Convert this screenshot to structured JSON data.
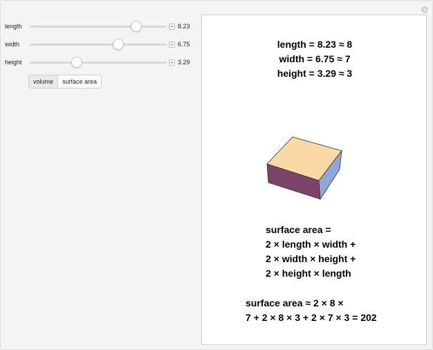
{
  "controls": [
    {
      "label": "length",
      "value": "8.23",
      "fraction": 0.8
    },
    {
      "label": "width",
      "value": "6.75",
      "fraction": 0.66
    },
    {
      "label": "height",
      "value": "3.29",
      "fraction": 0.33
    }
  ],
  "toggle": {
    "options": [
      "volume",
      "surface area"
    ],
    "selected": "surface area"
  },
  "display": {
    "dims": [
      "length = 8.23 ≈ 8",
      "width = 6.75 ≈ 7",
      "height = 3.29 ≈ 3"
    ],
    "formula": [
      "surface area =",
      "2 × length × width +",
      "2 × width × height +",
      "2 × height × length"
    ],
    "calc": [
      "surface area ≈ 2 × 8 ×",
      "7 + 2 × 8 × 3 + 2 × 7 × 3 = 202"
    ]
  },
  "colors": {
    "box_top": "#fbd9a6",
    "box_front": "#7a4367",
    "box_side": "#8ea9d8"
  },
  "icons": {
    "close": "close-icon",
    "increment": "plus-icon"
  }
}
